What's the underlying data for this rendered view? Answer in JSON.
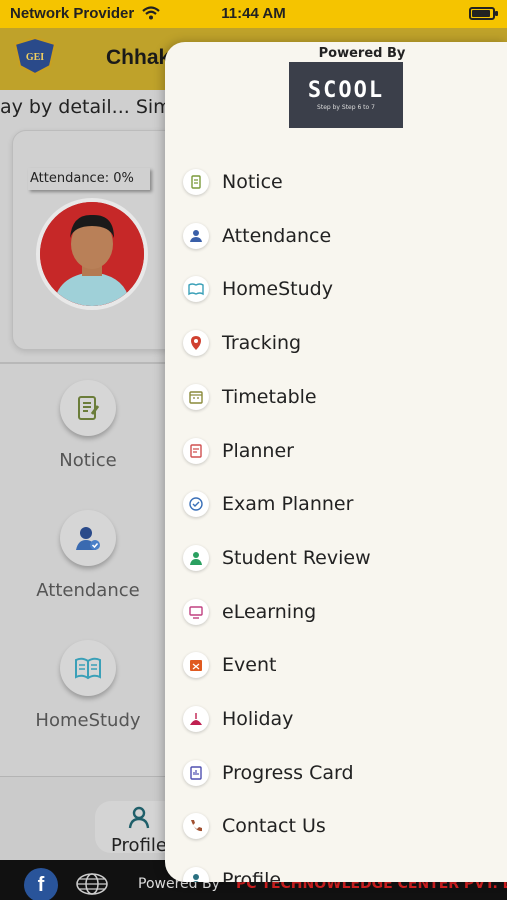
{
  "status_bar": {
    "carrier": "Network Provider",
    "time": "11:44 AM"
  },
  "header": {
    "title": "Chhak"
  },
  "marquee": {
    "text": "ay by detail... Simp"
  },
  "profile": {
    "attendance_label": "Attendance: 0%"
  },
  "dashboard": {
    "items": [
      {
        "label": "Notice",
        "icon": "notice-icon"
      },
      {
        "label": "Attendance",
        "icon": "attendance-icon"
      },
      {
        "label": "HomeStudy",
        "icon": "homestudy-icon"
      }
    ]
  },
  "bottom_tab": {
    "label": "Profile"
  },
  "footer": {
    "powered": "Powered By",
    "company": "PC TECHNOWLEDGE CENTER PVT. LTD"
  },
  "drawer": {
    "powered_by": "Powered By",
    "brand": "SCOOL",
    "brand_tag": "Step by Step 6 to 7",
    "menu": [
      {
        "label": "Notice",
        "icon": "notice-icon",
        "color": "#7a9a3a"
      },
      {
        "label": "Attendance",
        "icon": "attendance-icon",
        "color": "#3a5fa8"
      },
      {
        "label": "HomeStudy",
        "icon": "book-icon",
        "color": "#3aa0b8"
      },
      {
        "label": "Tracking",
        "icon": "location-pin-icon",
        "color": "#d04030"
      },
      {
        "label": "Timetable",
        "icon": "timetable-icon",
        "color": "#8a8a3a"
      },
      {
        "label": "Planner",
        "icon": "planner-icon",
        "color": "#d05050"
      },
      {
        "label": "Exam Planner",
        "icon": "exam-icon",
        "color": "#3a70b8"
      },
      {
        "label": "Student Review",
        "icon": "review-icon",
        "color": "#2aa060"
      },
      {
        "label": "eLearning",
        "icon": "elearning-icon",
        "color": "#c04080"
      },
      {
        "label": "Event",
        "icon": "event-icon",
        "color": "#e05a20"
      },
      {
        "label": "Holiday",
        "icon": "holiday-icon",
        "color": "#c02050"
      },
      {
        "label": "Progress Card",
        "icon": "progress-card-icon",
        "color": "#5050b0"
      },
      {
        "label": "Contact Us",
        "icon": "phone-icon",
        "color": "#a05030"
      },
      {
        "label": "Profile",
        "icon": "profile-icon",
        "color": "#2a7080"
      }
    ]
  }
}
